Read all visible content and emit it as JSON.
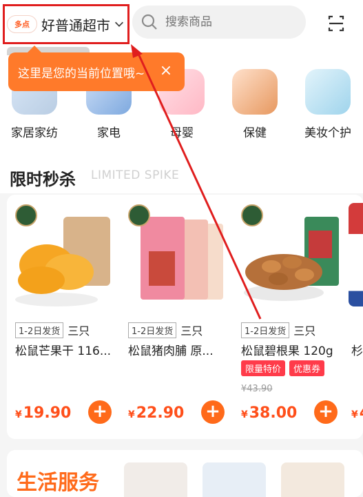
{
  "topbar": {
    "store_badge": "多点",
    "store_name": "好普通超市",
    "search_placeholder": "搜索商品"
  },
  "tooltip": {
    "text": "这里是您的当前位置哦~",
    "close": "×"
  },
  "categories": [
    {
      "label": "家居家纺"
    },
    {
      "label": "家电"
    },
    {
      "label": "母婴"
    },
    {
      "label": "保健"
    },
    {
      "label": "美妆个护"
    }
  ],
  "flash_sale": {
    "title": "限时秒杀",
    "subtitle": "LIMITED SPIKE"
  },
  "products": [
    {
      "ship": "1-2日发货",
      "brand": "三只",
      "title": "松鼠芒果干 116...",
      "price_currency": "¥",
      "price": "19.90",
      "orig_price": "",
      "promos": []
    },
    {
      "ship": "1-2日发货",
      "brand": "三只",
      "title": "松鼠猪肉脯 原...",
      "price_currency": "¥",
      "price": "22.90",
      "orig_price": "",
      "promos": []
    },
    {
      "ship": "1-2日发货",
      "brand": "三只",
      "title": "松鼠碧根果 120g",
      "price_currency": "¥",
      "price": "38.00",
      "orig_price": "¥43.90",
      "promos": [
        "限量特价",
        "优惠券"
      ]
    },
    {
      "ship": "",
      "brand": "",
      "title": "杉",
      "price_currency": "¥",
      "price": "4",
      "orig_price": "",
      "promos": []
    }
  ],
  "life_service": {
    "title": "生活服务"
  },
  "colors": {
    "accent": "#ff6a1a",
    "highlight": "#e01e1e",
    "promo": "#ff3b4a"
  }
}
